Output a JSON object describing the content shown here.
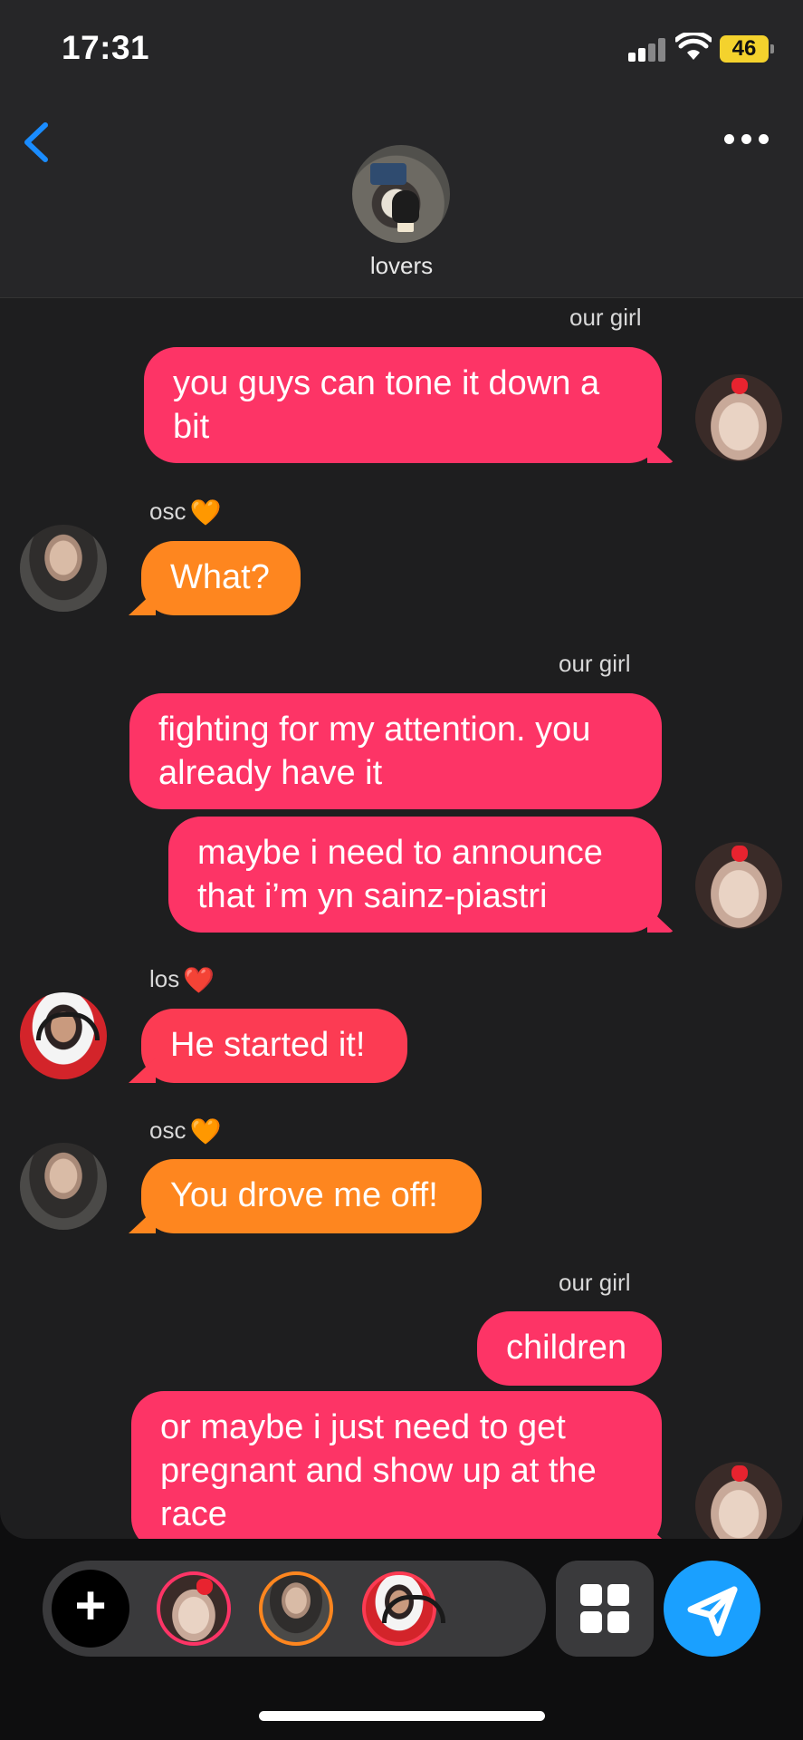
{
  "status_bar": {
    "time": "17:31",
    "battery": "46"
  },
  "header": {
    "group_name": "lovers"
  },
  "messages": [
    {
      "sender": "our girl",
      "text": "you guys can tone it down a bit"
    },
    {
      "sender": "osc",
      "sender_emoji": "🧡",
      "text": "What?"
    },
    {
      "sender": "our girl",
      "text": "fighting for my attention. you already have it"
    },
    {
      "sender": "our girl",
      "text": "maybe i need to announce that i’m yn sainz-piastri"
    },
    {
      "sender": "los",
      "sender_emoji": "❤️",
      "text": "He started it!"
    },
    {
      "sender": "osc",
      "sender_emoji": "🧡",
      "text": "You drove me off!"
    },
    {
      "sender": "our girl",
      "text": "children"
    },
    {
      "sender": "our girl",
      "text": "or maybe i just need to get pregnant and show up at the race"
    }
  ],
  "colors": {
    "pink_bubble": "#fd3466",
    "orange_bubble": "#fe861f",
    "send_button": "#1aa0ff"
  },
  "composer": {
    "plus_label": "+"
  },
  "icons": [
    "chevron-left-icon",
    "more-icon",
    "plus-icon",
    "grid-icon",
    "send-icon",
    "signal-icon",
    "wifi-icon",
    "battery-icon"
  ]
}
